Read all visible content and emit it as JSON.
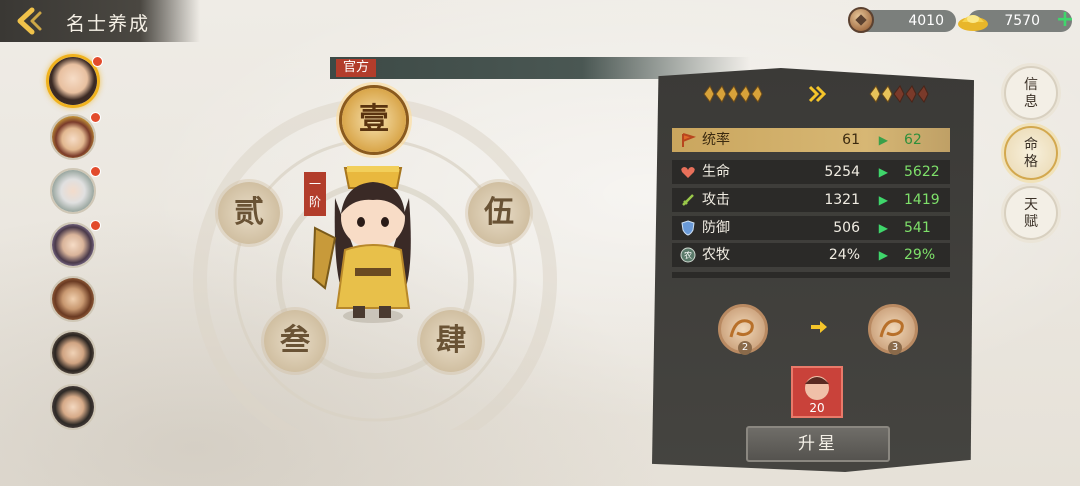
{
  "header": {
    "title": "名士养成",
    "currencies": [
      {
        "name": "copper-coin",
        "value": "4010"
      },
      {
        "name": "gold-ingot",
        "value": "7570"
      }
    ]
  },
  "rank": {
    "label": "官方"
  },
  "ring": {
    "nodes": [
      "壹",
      "贰",
      "叁",
      "肆",
      "伍"
    ],
    "tier_label": "一阶"
  },
  "stars": {
    "current_count": 5,
    "next_count": 5
  },
  "stats": [
    {
      "label": "统率",
      "current": "61",
      "next": "62",
      "highlight": true
    },
    {
      "label": "生命",
      "current": "5254",
      "next": "5622"
    },
    {
      "label": "攻击",
      "current": "1321",
      "next": "1419"
    },
    {
      "label": "防御",
      "current": "506",
      "next": "541"
    },
    {
      "label": "农牧",
      "current": "24%",
      "next": "29%"
    }
  ],
  "medals": {
    "current_level": "2",
    "next_level": "3"
  },
  "item": {
    "count": "20"
  },
  "upgrade_button": "升星",
  "tabs": [
    {
      "line1": "信",
      "line2": "息"
    },
    {
      "line1": "命",
      "line2": "格"
    },
    {
      "line1": "天",
      "line2": "赋"
    }
  ],
  "colors": {
    "accent_gold": "#d9a64a",
    "panel_dark": "#3b3a37",
    "increase_green": "#7ee06a",
    "badge_red": "#b23d2b"
  }
}
